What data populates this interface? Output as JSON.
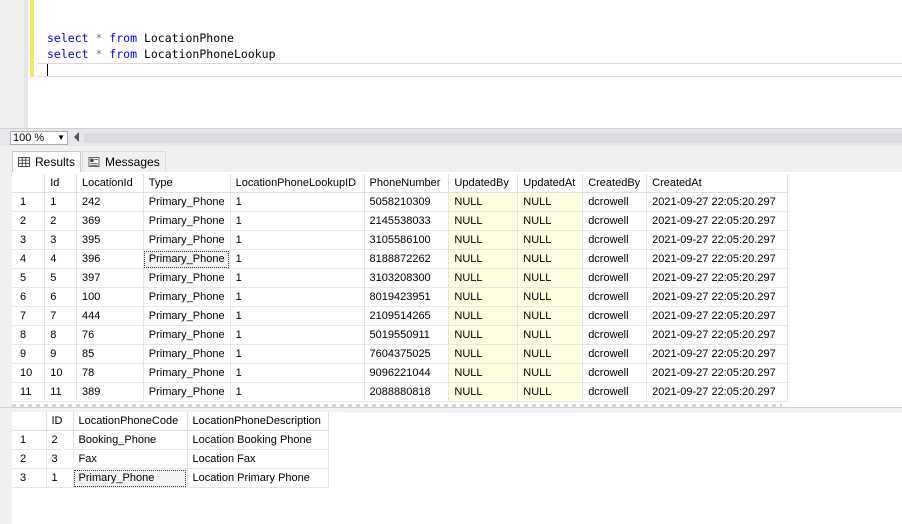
{
  "editor": {
    "line1": {
      "kw1": "select",
      "op": " * ",
      "kw2": "from",
      "rest": " LocationPhone"
    },
    "line2": {
      "kw1": "select",
      "op": " * ",
      "kw2": "from",
      "rest": " LocationPhoneLookup"
    }
  },
  "zoom": {
    "value": "100 %"
  },
  "tabs": {
    "results": "Results",
    "messages": "Messages"
  },
  "grid1": {
    "columns": [
      "",
      "Id",
      "LocationId",
      "Type",
      "LocationPhoneLookupID",
      "PhoneNumber",
      "UpdatedBy",
      "UpdatedAt",
      "CreatedBy",
      "CreatedAt"
    ],
    "rows": [
      [
        "1",
        "1",
        "242",
        "Primary_Phone",
        "1",
        "5058210309",
        "NULL",
        "NULL",
        "dcrowell",
        "2021-09-27 22:05:20.297"
      ],
      [
        "2",
        "2",
        "369",
        "Primary_Phone",
        "1",
        "2145538033",
        "NULL",
        "NULL",
        "dcrowell",
        "2021-09-27 22:05:20.297"
      ],
      [
        "3",
        "3",
        "395",
        "Primary_Phone",
        "1",
        "3105586100",
        "NULL",
        "NULL",
        "dcrowell",
        "2021-09-27 22:05:20.297"
      ],
      [
        "4",
        "4",
        "396",
        "Primary_Phone",
        "1",
        "8188872262",
        "NULL",
        "NULL",
        "dcrowell",
        "2021-09-27 22:05:20.297"
      ],
      [
        "5",
        "5",
        "397",
        "Primary_Phone",
        "1",
        "3103208300",
        "NULL",
        "NULL",
        "dcrowell",
        "2021-09-27 22:05:20.297"
      ],
      [
        "6",
        "6",
        "100",
        "Primary_Phone",
        "1",
        "8019423951",
        "NULL",
        "NULL",
        "dcrowell",
        "2021-09-27 22:05:20.297"
      ],
      [
        "7",
        "7",
        "444",
        "Primary_Phone",
        "1",
        "2109514265",
        "NULL",
        "NULL",
        "dcrowell",
        "2021-09-27 22:05:20.297"
      ],
      [
        "8",
        "8",
        "76",
        "Primary_Phone",
        "1",
        "5019550911",
        "NULL",
        "NULL",
        "dcrowell",
        "2021-09-27 22:05:20.297"
      ],
      [
        "9",
        "9",
        "85",
        "Primary_Phone",
        "1",
        "7604375025",
        "NULL",
        "NULL",
        "dcrowell",
        "2021-09-27 22:05:20.297"
      ],
      [
        "10",
        "10",
        "78",
        "Primary_Phone",
        "1",
        "9096221044",
        "NULL",
        "NULL",
        "dcrowell",
        "2021-09-27 22:05:20.297"
      ],
      [
        "11",
        "11",
        "389",
        "Primary_Phone",
        "1",
        "2088880818",
        "NULL",
        "NULL",
        "dcrowell",
        "2021-09-27 22:05:20.297"
      ]
    ],
    "selected": {
      "row": 3,
      "col": 3
    }
  },
  "grid2": {
    "columns": [
      "",
      "ID",
      "LocationPhoneCode",
      "LocationPhoneDescription"
    ],
    "rows": [
      [
        "1",
        "2",
        "Booking_Phone",
        "Location Booking Phone"
      ],
      [
        "2",
        "3",
        "Fax",
        "Location Fax"
      ],
      [
        "3",
        "1",
        "Primary_Phone",
        "Location Primary Phone"
      ]
    ],
    "selected": {
      "row": 2,
      "col": 2
    }
  },
  "colors": {
    "null_bg": "#ffffe1",
    "keyword": "#0000ff",
    "change_bar": "#f5e96b"
  }
}
